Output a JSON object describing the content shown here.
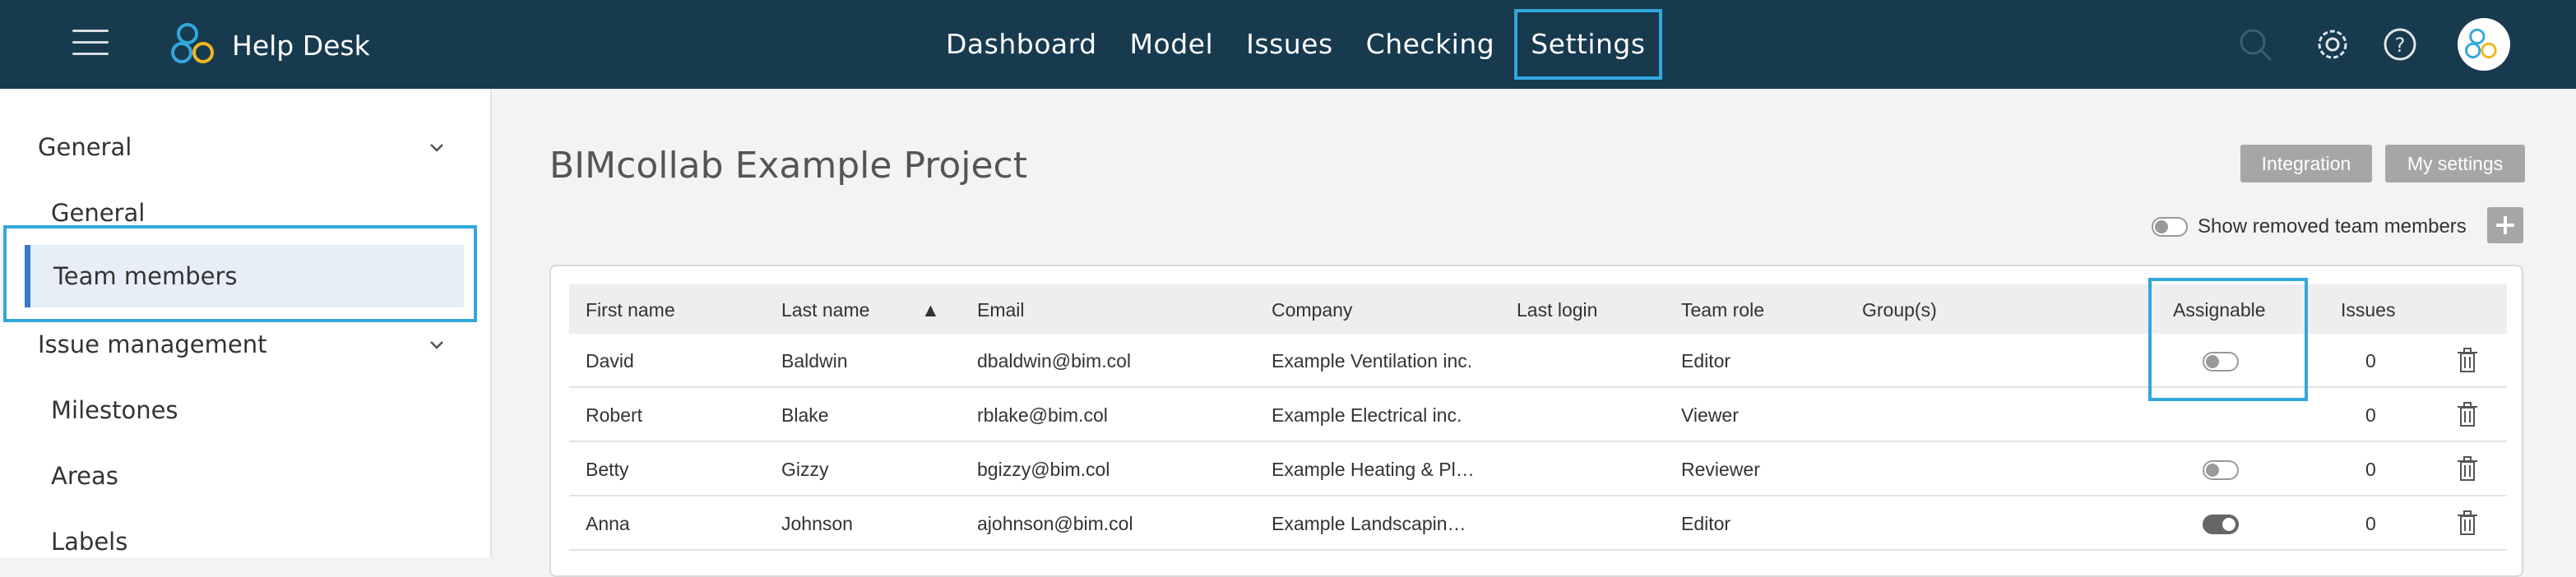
{
  "header": {
    "brand": "Help Desk",
    "nav": [
      "Dashboard",
      "Model",
      "Issues",
      "Checking",
      "Settings"
    ],
    "active_nav": "Settings",
    "icons": [
      "search-icon",
      "gear-icon",
      "help-icon",
      "avatar"
    ]
  },
  "sidebar": {
    "sections": [
      {
        "label": "General",
        "items": [
          "General",
          "Team members"
        ]
      },
      {
        "label": "Issue management",
        "items": [
          "Milestones",
          "Areas",
          "Labels"
        ]
      }
    ],
    "active_item": "Team members"
  },
  "main": {
    "title": "BIMcollab Example Project",
    "buttons": {
      "integration": "Integration",
      "my_settings": "My settings"
    },
    "show_removed_label": "Show removed team members",
    "columns": [
      "First name",
      "Last name",
      "▲",
      "Email",
      "Company",
      "Last login",
      "Team role",
      "Group(s)",
      "Assignable",
      "Issues"
    ],
    "rows": [
      {
        "first": "David",
        "last": "Baldwin",
        "email": "dbaldwin@bim.col",
        "company": "Example Ventilation inc.",
        "login": "",
        "role": "Editor",
        "groups": "",
        "assignable": "off",
        "issues": "0"
      },
      {
        "first": "Robert",
        "last": "Blake",
        "email": "rblake@bim.col",
        "company": "Example Electrical inc.",
        "login": "",
        "role": "Viewer",
        "groups": "",
        "assignable": "none",
        "issues": "0"
      },
      {
        "first": "Betty",
        "last": "Gizzy",
        "email": "bgizzy@bim.col",
        "company": "Example Heating & Pl…",
        "login": "",
        "role": "Reviewer",
        "groups": "",
        "assignable": "off",
        "issues": "0"
      },
      {
        "first": "Anna",
        "last": "Johnson",
        "email": "ajohnson@bim.col",
        "company": "Example Landscapin…",
        "login": "",
        "role": "Editor",
        "groups": "",
        "assignable": "on",
        "issues": "0"
      }
    ]
  },
  "colors": {
    "header_bg": "#173a4f",
    "highlight": "#32a7dc",
    "active_bar": "#3a78c8",
    "button_grey": "#a6a6a6"
  }
}
